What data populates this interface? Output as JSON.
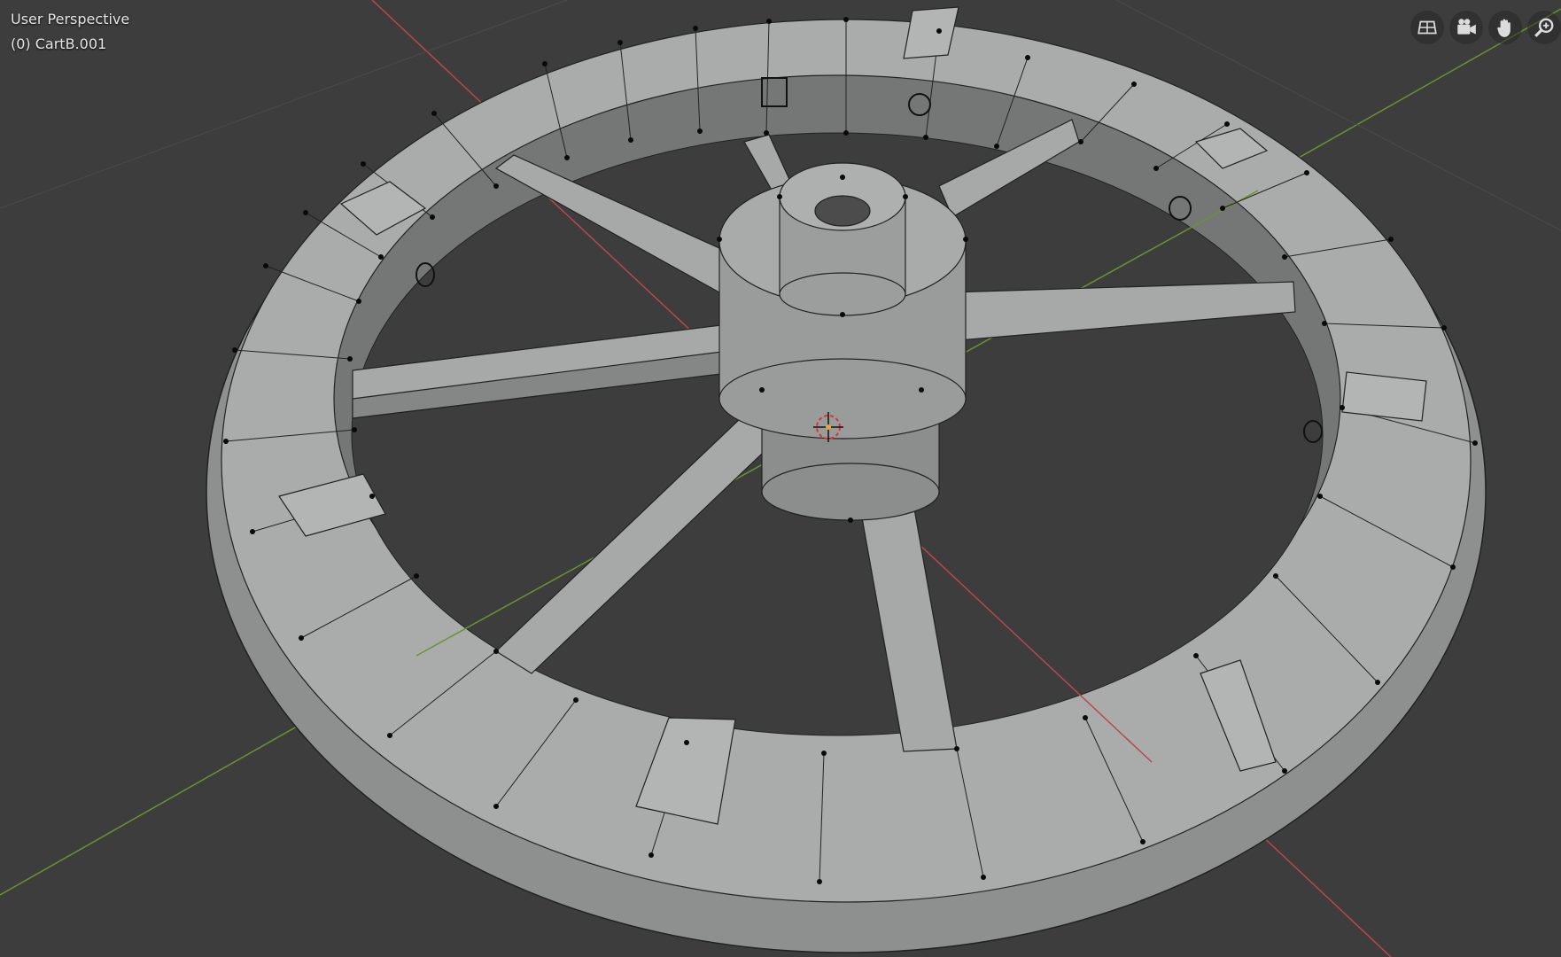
{
  "viewport": {
    "view_mode": "User Perspective",
    "object_label": "(0) CartB.001"
  },
  "nav_gizmos": [
    {
      "name": "toggle-grid-view-icon"
    },
    {
      "name": "camera-view-icon"
    },
    {
      "name": "pan-view-hand-icon"
    },
    {
      "name": "zoom-view-icon"
    }
  ],
  "colors": {
    "background": "#3d3d3d",
    "x_axis": "#b8474f",
    "y_axis": "#6a9232",
    "mesh_top": "#a9abab",
    "mesh_side": "#8c8e8e",
    "mesh_inner": "#707272",
    "mesh_edge": "#2a2a2a",
    "vertex": "#0a0a0a"
  }
}
